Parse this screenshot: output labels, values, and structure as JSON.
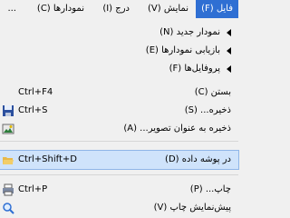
{
  "menubar": {
    "items": [
      {
        "label": "فایل (F)",
        "active": true
      },
      {
        "label": "نمایش (V)"
      },
      {
        "label": "درج (I)"
      },
      {
        "label": "نمودارها (C)"
      },
      {
        "label": "..."
      }
    ]
  },
  "menu": {
    "new_chart": {
      "label": "نمودار جدید (N)"
    },
    "reopen_charts": {
      "label": "بازیابی نمودارها (E)"
    },
    "profiles": {
      "label": "پروفایل‌ها (F)"
    },
    "close": {
      "label": "بستن (C)",
      "shortcut": "Ctrl+F4"
    },
    "save": {
      "label": "ذخیره... (S)",
      "shortcut": "Ctrl+S"
    },
    "save_as_picture": {
      "label": "ذخیره به عنوان تصویر... (A)"
    },
    "data_folder": {
      "label": "در پوشه داده (D)",
      "shortcut": "Ctrl+Shift+D"
    },
    "print": {
      "label": "چاپ... (P)",
      "shortcut": "Ctrl+P"
    },
    "print_preview": {
      "label": "پیش‌نمایش چاپ (V)"
    }
  },
  "colors": {
    "menubar_active": "#2f6fd3",
    "highlight": "#cfe3fb"
  }
}
